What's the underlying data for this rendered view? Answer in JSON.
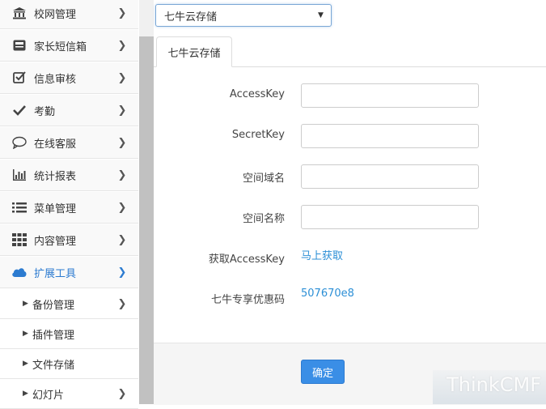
{
  "sidebar": {
    "items": [
      {
        "label": "校网管理",
        "icon": "bank-icon"
      },
      {
        "label": "家长短信箱",
        "icon": "inbox-icon"
      },
      {
        "label": "信息审核",
        "icon": "checkbox-icon"
      },
      {
        "label": "考勤",
        "icon": "checkmark-icon"
      },
      {
        "label": "在线客服",
        "icon": "chat-bubble-icon"
      },
      {
        "label": "统计报表",
        "icon": "bar-chart-icon"
      },
      {
        "label": "菜单管理",
        "icon": "list-icon"
      },
      {
        "label": "内容管理",
        "icon": "grid-icon"
      },
      {
        "label": "扩展工具",
        "icon": "cloud-icon"
      }
    ],
    "subitems": [
      {
        "label": "备份管理",
        "has_chevron": true
      },
      {
        "label": "插件管理",
        "has_chevron": false
      },
      {
        "label": "文件存储",
        "has_chevron": false
      },
      {
        "label": "幻灯片",
        "has_chevron": true
      }
    ],
    "accent_color": "#2c7bd0"
  },
  "storage_select": {
    "value": "七牛云存储"
  },
  "tab": {
    "label": "七牛云存储"
  },
  "form": {
    "access_key_label": "AccessKey",
    "secret_key_label": "SecretKey",
    "domain_label": "空间域名",
    "bucket_label": "空间名称",
    "get_key_label": "获取AccessKey",
    "get_key_link": "马上获取",
    "promo_label": "七牛专享优惠码",
    "promo_code": "507670e8"
  },
  "confirm_button": "确定",
  "watermark": "ThinkCMF",
  "colors": {
    "link": "#2c8fd6",
    "button": "#3a8ee6"
  }
}
